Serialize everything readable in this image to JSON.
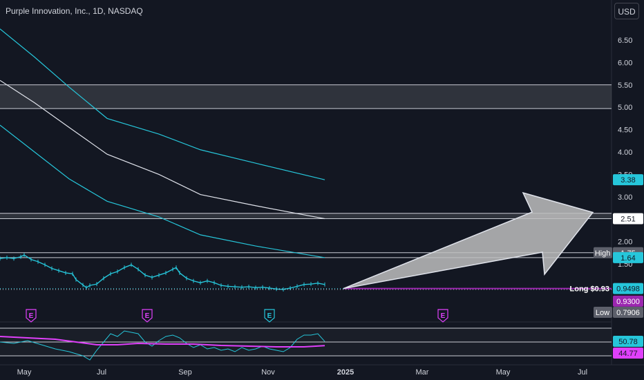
{
  "header": {
    "title": "Purple Innovation, Inc., 1D, NASDAQ",
    "currency": "USD"
  },
  "colors": {
    "background": "#131722",
    "cyan": "#26c6da",
    "white": "#e0e3eb",
    "magenta": "#e040fb",
    "grid": "#2a2e39",
    "text": "#d1d4dc",
    "price_line": "#9c27b0"
  },
  "chart_data": {
    "type": "line",
    "title": "",
    "x_ticks": [
      "May",
      "Jul",
      "Sep",
      "Nov",
      "2025",
      "Mar",
      "May",
      "Jul"
    ],
    "y_ticks": [
      6.5,
      6.0,
      5.5,
      5.0,
      4.5,
      4.0,
      3.5,
      3.0,
      2.5,
      2.0,
      1.5
    ],
    "ylim": [
      1.0,
      7.0
    ],
    "price_series": {
      "name": "",
      "x": [
        0,
        10,
        20,
        30,
        35,
        45,
        55,
        65,
        75,
        85,
        95,
        105,
        110,
        120,
        125,
        130,
        140,
        150,
        160,
        170,
        180,
        190,
        200,
        210,
        220,
        230,
        240,
        250,
        255,
        260,
        270,
        280,
        290,
        300,
        310,
        320,
        330,
        340,
        350,
        360,
        370,
        380,
        390,
        400,
        410,
        420,
        430,
        440,
        450,
        460,
        470
      ],
      "y": [
        1.62,
        1.64,
        1.62,
        1.66,
        1.7,
        1.6,
        1.55,
        1.48,
        1.4,
        1.35,
        1.3,
        1.28,
        1.15,
        1.03,
        0.97,
        1.02,
        1.05,
        1.18,
        1.28,
        1.33,
        1.42,
        1.48,
        1.38,
        1.25,
        1.2,
        1.25,
        1.3,
        1.38,
        1.42,
        1.3,
        1.18,
        1.12,
        1.08,
        1.12,
        1.08,
        1.02,
        1.0,
        0.99,
        0.98,
        0.99,
        0.97,
        0.98,
        0.96,
        0.94,
        0.93,
        0.96,
        1.0,
        1.04,
        1.05,
        1.07,
        1.04
      ]
    },
    "series": [
      {
        "name": "",
        "color": "#26c6da",
        "x": [
          0,
          50,
          100,
          155,
          230,
          290,
          370,
          470
        ],
        "y": [
          6.75,
          6.12,
          5.45,
          4.75,
          4.4,
          4.05,
          3.75,
          3.38
        ]
      },
      {
        "name": "",
        "color": "#e0e3eb",
        "x": [
          0,
          50,
          100,
          155,
          230,
          290,
          370,
          470
        ],
        "y": [
          5.6,
          5.1,
          4.55,
          3.95,
          3.5,
          3.05,
          2.8,
          2.51
        ]
      },
      {
        "name": "",
        "color": "#26c6da",
        "x": [
          0,
          50,
          100,
          155,
          230,
          290,
          370,
          470
        ],
        "y": [
          4.6,
          4.0,
          3.4,
          2.9,
          2.55,
          2.15,
          1.9,
          1.64
        ]
      }
    ],
    "horizontal_levels": [
      5.5,
      4.97,
      2.63,
      2.51,
      1.75,
      1.64
    ],
    "zones": [
      {
        "from": 4.97,
        "to": 5.5
      },
      {
        "from": 2.51,
        "to": 2.63
      }
    ],
    "price_labels": [
      {
        "text": "3.38",
        "value": 3.38,
        "style": "cyan"
      },
      {
        "text": "2.51",
        "value": 2.51,
        "style": "white"
      },
      {
        "text": "1.75",
        "value": 1.75,
        "style": "gray",
        "tag": "High"
      },
      {
        "text": "1.64",
        "value": 1.64,
        "style": "cyan"
      },
      {
        "text": "0.9498",
        "value": 0.9498,
        "style": "cyan",
        "tag": "Long $0.93"
      },
      {
        "text": "0.9300",
        "value": 0.93,
        "style": "purple"
      },
      {
        "text": "0.7906",
        "value": 0.7906,
        "style": "gray",
        "tag": "Low"
      }
    ],
    "earnings_markers": [
      {
        "x": 45,
        "label": "E",
        "color": "#e040fb"
      },
      {
        "x": 213,
        "label": "E",
        "color": "#e040fb"
      },
      {
        "x": 390,
        "label": "E",
        "color": "#26c6da"
      },
      {
        "x": 641,
        "label": "E",
        "color": "#e040fb"
      }
    ],
    "arrow": {
      "from_x": 497,
      "from_y": 0.95,
      "to_x": 858,
      "to_y": 2.65
    },
    "indicator": {
      "ylim": [
        20,
        80
      ],
      "levels": [
        70,
        50,
        30
      ],
      "labels": [
        {
          "text": "50.78",
          "value": 50.78,
          "style": "cyan"
        },
        {
          "text": "44.77",
          "value": 44.77,
          "style": "magenta"
        }
      ],
      "rsi": {
        "x": [
          0,
          20,
          40,
          60,
          80,
          100,
          120,
          130,
          140,
          150,
          160,
          170,
          180,
          190,
          200,
          210,
          220,
          230,
          240,
          250,
          260,
          270,
          280,
          290,
          300,
          310,
          320,
          330,
          340,
          350,
          360,
          370,
          380,
          390,
          400,
          410,
          420,
          430,
          440,
          450,
          460,
          470
        ],
        "y": [
          50,
          48,
          52,
          46,
          40,
          36,
          30,
          24,
          38,
          50,
          62,
          58,
          66,
          64,
          62,
          50,
          44,
          52,
          58,
          60,
          56,
          48,
          42,
          46,
          40,
          42,
          38,
          40,
          36,
          42,
          38,
          40,
          44,
          40,
          38,
          36,
          42,
          54,
          60,
          60,
          62,
          50.78
        ]
      },
      "ma": {
        "x": [
          0,
          40,
          80,
          110,
          140,
          170,
          200,
          240,
          280,
          320,
          360,
          400,
          440,
          470
        ],
        "y": [
          58,
          56,
          54,
          50,
          46,
          46,
          48,
          47,
          47,
          45,
          44,
          43,
          43,
          44.77
        ]
      }
    }
  }
}
